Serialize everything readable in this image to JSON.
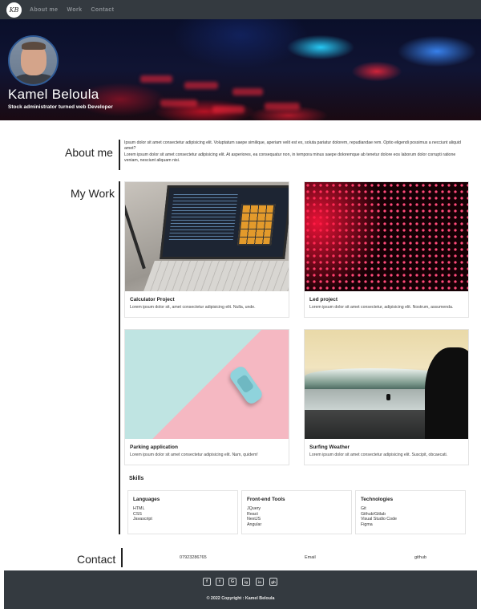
{
  "nav": {
    "logo_text": "KB",
    "links": [
      "About me",
      "Work",
      "Contact"
    ]
  },
  "hero": {
    "name": "Kamel Beloula",
    "subtitle": "Stock administrator turned web Developer"
  },
  "about": {
    "title": "About me",
    "paragraph1": "Ipsum dolor sit amet consectetur adipisicing elit. Voluptatum saepe similique, aperiam velit est ex, soluta pariatur dolorem, repudiandae rem. Optio eligendi possimus a necciunt aliquid amet?",
    "paragraph2": "Lorem ipsum dolor sit amet consectetur adipisicing elit. At asperiores, ea consequatur non, in tempora minus saepe doloremque ab tenetur dolore eos laborum dolor corrupti ratione veniam, nesciunt aliquam nisi."
  },
  "work": {
    "title": "My Work",
    "projects": [
      {
        "title": "Calculator Project",
        "description": "Lorem ipsum dolor sit, amet consectetur adipisicing elit. Nulla, unde."
      },
      {
        "title": "Led project",
        "description": "Lorem ipsum dolor sit amet consectetur, adipisicing elit. Nostrum, assumenda."
      },
      {
        "title": "Parking application",
        "description": "Lorem ipsum dolor sit amet consectetur adipisicing elit. Nam, quidem!"
      },
      {
        "title": "Surfing Weather",
        "description": "Lorem ipsum dolor sit amet consectetur adipisicing elit. Suscipit, obcaecati."
      }
    ]
  },
  "skills": {
    "title": "Skills",
    "groups": [
      {
        "heading": "Languages",
        "items": [
          "HTML",
          "CSS",
          "Javascript"
        ]
      },
      {
        "heading": "Front-end Tools",
        "items": [
          "JQuery",
          "React",
          "NextJS",
          "Angular"
        ]
      },
      {
        "heading": "Technologies",
        "items": [
          "Git",
          "Github/Gitlab",
          "Visual Studio Code",
          "Figma"
        ]
      }
    ]
  },
  "contact": {
    "title": "Contact",
    "phone": "07923286765",
    "email": "Email",
    "github": "github"
  },
  "footer": {
    "social": [
      "f",
      "t",
      "G",
      "ig",
      "in",
      "gh"
    ],
    "copyright": "© 2022 Copyright : Kamel Beloula"
  },
  "colors": {
    "navbar": "#343a40",
    "footer": "#343a40",
    "text": "#222222"
  }
}
